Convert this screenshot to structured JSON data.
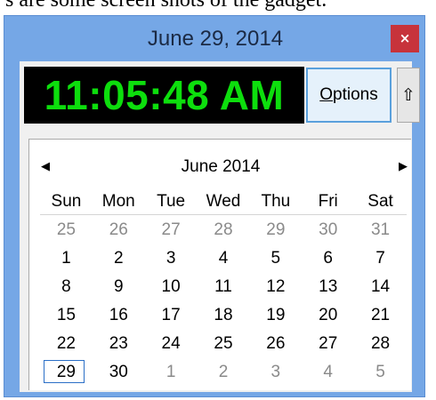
{
  "caption": "s are some screen shots of the gadget.",
  "window": {
    "title": "June 29, 2014",
    "close_label": "×"
  },
  "clock": {
    "time": "11:05:48 AM"
  },
  "toolbar": {
    "options_first": "O",
    "options_rest": "ptions",
    "collapse_glyph": "⇧"
  },
  "calendar": {
    "prev_glyph": "◀",
    "next_glyph": "▶",
    "month_label": "June 2014",
    "weekdays": [
      "Sun",
      "Mon",
      "Tue",
      "Wed",
      "Thu",
      "Fri",
      "Sat"
    ],
    "weeks": [
      [
        {
          "d": "25",
          "other": true
        },
        {
          "d": "26",
          "other": true
        },
        {
          "d": "27",
          "other": true
        },
        {
          "d": "28",
          "other": true
        },
        {
          "d": "29",
          "other": true
        },
        {
          "d": "30",
          "other": true
        },
        {
          "d": "31",
          "other": true
        }
      ],
      [
        {
          "d": "1"
        },
        {
          "d": "2"
        },
        {
          "d": "3"
        },
        {
          "d": "4"
        },
        {
          "d": "5"
        },
        {
          "d": "6"
        },
        {
          "d": "7"
        }
      ],
      [
        {
          "d": "8"
        },
        {
          "d": "9"
        },
        {
          "d": "10"
        },
        {
          "d": "11"
        },
        {
          "d": "12"
        },
        {
          "d": "13"
        },
        {
          "d": "14"
        }
      ],
      [
        {
          "d": "15"
        },
        {
          "d": "16"
        },
        {
          "d": "17"
        },
        {
          "d": "18"
        },
        {
          "d": "19"
        },
        {
          "d": "20"
        },
        {
          "d": "21"
        }
      ],
      [
        {
          "d": "22"
        },
        {
          "d": "23"
        },
        {
          "d": "24"
        },
        {
          "d": "25"
        },
        {
          "d": "26"
        },
        {
          "d": "27"
        },
        {
          "d": "28"
        }
      ],
      [
        {
          "d": "29",
          "today": true
        },
        {
          "d": "30"
        },
        {
          "d": "1",
          "other": true
        },
        {
          "d": "2",
          "other": true
        },
        {
          "d": "3",
          "other": true
        },
        {
          "d": "4",
          "other": true
        },
        {
          "d": "5",
          "other": true
        }
      ]
    ]
  },
  "colors": {
    "window_frame": "#75a7e6",
    "close_button": "#c7333b",
    "clock_text": "#0dde0d",
    "clock_bg": "#000000",
    "today_border": "#2b6fc7",
    "other_month_text": "#8a8a8a"
  }
}
